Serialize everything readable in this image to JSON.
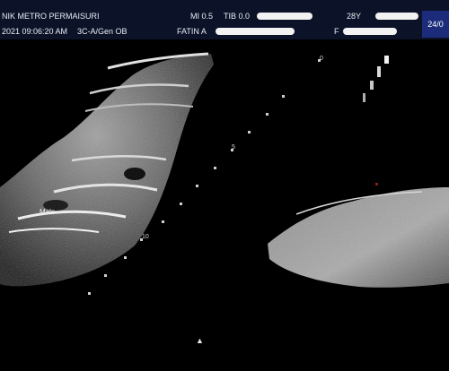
{
  "header": {
    "clinic": "NIK METRO PERMAISURI",
    "datetime": "2021 09:06:20 AM",
    "probe": "3C-A/Gen OB",
    "mi": "MI 0.5",
    "tib": "TIB 0.0",
    "patient_name": "FATIN A",
    "age": "28Y",
    "sex": "F",
    "date_partial": "24/0"
  },
  "scale": {
    "depth_labels": [
      "0",
      "5",
      "10"
    ]
  },
  "annotations": {
    "fetal_label": "Male"
  },
  "markers": {
    "focus": "▲"
  }
}
